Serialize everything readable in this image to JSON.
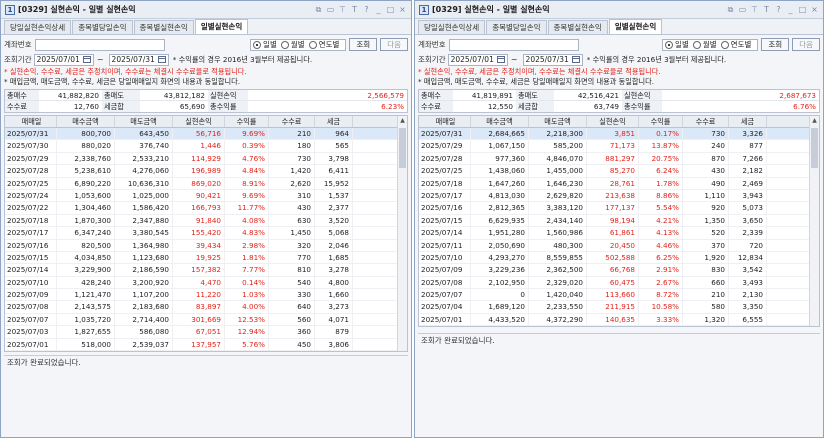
{
  "windows": [
    {
      "title": "[0329] 실현손익 - 일별 실현손익",
      "app_icon": "1",
      "tabs": [
        {
          "label": "당일실현손익상세"
        },
        {
          "label": "종목별당일손익"
        },
        {
          "label": "종목별실현손익"
        },
        {
          "label": "일별실현손익"
        }
      ],
      "account_label": "계좌번호",
      "radios": [
        {
          "label": "일별"
        },
        {
          "label": "월별"
        },
        {
          "label": "연도별"
        }
      ],
      "query_btn": "조회",
      "next_btn": "다음",
      "period_label": "조회기간",
      "date_from": "2025/07/01",
      "date_to": "2025/07/31",
      "date_tilde": "~",
      "note": "* 수익률의 경우 2016년 3월부터 제공됩니다.",
      "red_note": "* 실현손익, 수수료, 세금은 추정치이며, 수수료는 체결시 수수료율로 적용됩니다.",
      "black_note": "* 매입금액, 매도금액, 수수료, 세금은 당일매매일지 화면의 내용과 동일합니다.",
      "summary": {
        "l_buy": "총매수",
        "buy": "41,882,820",
        "l_sell": "총매도",
        "sell": "43,812,182",
        "l_pl": "실현손익",
        "pl": "2,566,579",
        "l_fee": "수수료",
        "fee": "12,760",
        "l_tax": "세금합",
        "tax": "65,690",
        "l_rate": "총수익률",
        "rate": "6.23%"
      },
      "headers": [
        "매매일",
        "매수금액",
        "매도금액",
        "실현손익",
        "수익률",
        "수수료",
        "세금"
      ],
      "rows": [
        {
          "d": "2025/07/31",
          "b": "800,700",
          "s": "643,450",
          "p": "56,716",
          "r": "9.69%",
          "f": "210",
          "t": "964",
          "c": "pos"
        },
        {
          "d": "2025/07/30",
          "b": "880,020",
          "s": "376,740",
          "p": "1,446",
          "r": "0.39%",
          "f": "180",
          "t": "565",
          "c": "pos"
        },
        {
          "d": "2025/07/29",
          "b": "2,338,760",
          "s": "2,533,210",
          "p": "114,929",
          "r": "4.76%",
          "f": "730",
          "t": "3,798",
          "c": "pos"
        },
        {
          "d": "2025/07/28",
          "b": "5,238,610",
          "s": "4,276,060",
          "p": "196,989",
          "r": "4.84%",
          "f": "1,420",
          "t": "6,411",
          "c": "pos"
        },
        {
          "d": "2025/07/25",
          "b": "6,890,220",
          "s": "10,636,310",
          "p": "869,020",
          "r": "8.91%",
          "f": "2,620",
          "t": "15,952",
          "c": "pos"
        },
        {
          "d": "2025/07/24",
          "b": "1,053,600",
          "s": "1,025,000",
          "p": "90,421",
          "r": "9.69%",
          "f": "310",
          "t": "1,537",
          "c": "pos"
        },
        {
          "d": "2025/07/22",
          "b": "1,304,460",
          "s": "1,586,420",
          "p": "166,793",
          "r": "11.77%",
          "f": "430",
          "t": "2,377",
          "c": "pos"
        },
        {
          "d": "2025/07/18",
          "b": "1,870,300",
          "s": "2,347,880",
          "p": "91,840",
          "r": "4.08%",
          "f": "630",
          "t": "3,520",
          "c": "pos"
        },
        {
          "d": "2025/07/17",
          "b": "6,347,240",
          "s": "3,380,545",
          "p": "155,420",
          "r": "4.83%",
          "f": "1,450",
          "t": "5,068",
          "c": "pos"
        },
        {
          "d": "2025/07/16",
          "b": "820,500",
          "s": "1,364,980",
          "p": "39,434",
          "r": "2.98%",
          "f": "320",
          "t": "2,046",
          "c": "pos"
        },
        {
          "d": "2025/07/15",
          "b": "4,034,850",
          "s": "1,123,680",
          "p": "19,925",
          "r": "1.81%",
          "f": "770",
          "t": "1,685",
          "c": "pos"
        },
        {
          "d": "2025/07/14",
          "b": "3,229,900",
          "s": "2,186,590",
          "p": "157,382",
          "r": "7.77%",
          "f": "810",
          "t": "3,278",
          "c": "pos"
        },
        {
          "d": "2025/07/10",
          "b": "428,240",
          "s": "3,200,920",
          "p": "4,470",
          "r": "0.14%",
          "f": "540",
          "t": "4,800",
          "c": "pos"
        },
        {
          "d": "2025/07/09",
          "b": "1,121,470",
          "s": "1,107,200",
          "p": "11,220",
          "r": "1.03%",
          "f": "330",
          "t": "1,660",
          "c": "pos"
        },
        {
          "d": "2025/07/08",
          "b": "2,143,575",
          "s": "2,183,680",
          "p": "83,897",
          "r": "4.00%",
          "f": "640",
          "t": "3,273",
          "c": "pos"
        },
        {
          "d": "2025/07/07",
          "b": "1,035,720",
          "s": "2,714,400",
          "p": "301,669",
          "r": "12.53%",
          "f": "560",
          "t": "4,071",
          "c": "pos"
        },
        {
          "d": "2025/07/03",
          "b": "1,827,655",
          "s": "586,080",
          "p": "67,051",
          "r": "12.94%",
          "f": "360",
          "t": "879",
          "c": "pos"
        },
        {
          "d": "2025/07/01",
          "b": "518,000",
          "s": "2,539,037",
          "p": "137,957",
          "r": "5.76%",
          "f": "450",
          "t": "3,806",
          "c": "pos"
        }
      ],
      "status": "조회가 완료되었습니다."
    },
    {
      "title": "[0329] 실현손익 - 일별 실현손익",
      "app_icon": "1",
      "tabs": [
        {
          "label": "당일실현손익상세"
        },
        {
          "label": "종목별당일손익"
        },
        {
          "label": "종목별실현손익"
        },
        {
          "label": "일별실현손익"
        }
      ],
      "account_label": "계좌번호",
      "radios": [
        {
          "label": "일별"
        },
        {
          "label": "월별"
        },
        {
          "label": "연도별"
        }
      ],
      "query_btn": "조회",
      "next_btn": "다음",
      "period_label": "조회기간",
      "date_from": "2025/07/01",
      "date_to": "2025/07/31",
      "date_tilde": "~",
      "note": "* 수익률의 경우 2016년 3월부터 제공됩니다.",
      "red_note": "* 실현손익, 수수료, 세금은 추정치이며, 수수료는 체결시 수수료율로 적용됩니다.",
      "black_note": "* 매입금액, 매도금액, 수수료, 세금은 당일매매일지 화면의 내용과 동일합니다.",
      "summary": {
        "l_buy": "총매수",
        "buy": "41,819,891",
        "l_sell": "총매도",
        "sell": "42,516,421",
        "l_pl": "실현손익",
        "pl": "2,687,673",
        "l_fee": "수수료",
        "fee": "12,550",
        "l_tax": "세금합",
        "tax": "63,749",
        "l_rate": "총수익률",
        "rate": "6.76%"
      },
      "headers": [
        "매매일",
        "매수금액",
        "매도금액",
        "실현손익",
        "수익률",
        "수수료",
        "세금"
      ],
      "rows": [
        {
          "d": "2025/07/31",
          "b": "2,684,665",
          "s": "2,218,300",
          "p": "3,851",
          "r": "0.17%",
          "f": "730",
          "t": "3,326",
          "c": "pos"
        },
        {
          "d": "2025/07/29",
          "b": "1,067,150",
          "s": "585,200",
          "p": "71,173",
          "r": "13.87%",
          "f": "240",
          "t": "877",
          "c": "pos"
        },
        {
          "d": "2025/07/28",
          "b": "977,360",
          "s": "4,846,070",
          "p": "881,297",
          "r": "20.75%",
          "f": "870",
          "t": "7,266",
          "c": "pos"
        },
        {
          "d": "2025/07/25",
          "b": "1,438,060",
          "s": "1,455,000",
          "p": "85,270",
          "r": "6.24%",
          "f": "430",
          "t": "2,182",
          "c": "pos"
        },
        {
          "d": "2025/07/18",
          "b": "1,647,260",
          "s": "1,646,230",
          "p": "28,761",
          "r": "1.78%",
          "f": "490",
          "t": "2,469",
          "c": "pos"
        },
        {
          "d": "2025/07/17",
          "b": "4,813,030",
          "s": "2,629,820",
          "p": "213,638",
          "r": "8.86%",
          "f": "1,110",
          "t": "3,943",
          "c": "pos"
        },
        {
          "d": "2025/07/16",
          "b": "2,812,365",
          "s": "3,383,120",
          "p": "177,137",
          "r": "5.54%",
          "f": "920",
          "t": "5,073",
          "c": "pos"
        },
        {
          "d": "2025/07/15",
          "b": "6,629,935",
          "s": "2,434,140",
          "p": "98,194",
          "r": "4.21%",
          "f": "1,350",
          "t": "3,650",
          "c": "pos"
        },
        {
          "d": "2025/07/14",
          "b": "1,951,280",
          "s": "1,560,986",
          "p": "61,861",
          "r": "4.13%",
          "f": "520",
          "t": "2,339",
          "c": "pos"
        },
        {
          "d": "2025/07/11",
          "b": "2,050,690",
          "s": "480,300",
          "p": "20,450",
          "r": "4.46%",
          "f": "370",
          "t": "720",
          "c": "pos"
        },
        {
          "d": "2025/07/10",
          "b": "4,293,270",
          "s": "8,559,855",
          "p": "502,588",
          "r": "6.25%",
          "f": "1,920",
          "t": "12,834",
          "c": "pos"
        },
        {
          "d": "2025/07/09",
          "b": "3,229,236",
          "s": "2,362,500",
          "p": "66,768",
          "r": "2.91%",
          "f": "830",
          "t": "3,542",
          "c": "pos"
        },
        {
          "d": "2025/07/08",
          "b": "2,102,950",
          "s": "2,329,020",
          "p": "60,475",
          "r": "2.67%",
          "f": "660",
          "t": "3,493",
          "c": "pos"
        },
        {
          "d": "2025/07/07",
          "b": "0",
          "s": "1,420,040",
          "p": "113,660",
          "r": "8.72%",
          "f": "210",
          "t": "2,130",
          "c": "pos"
        },
        {
          "d": "2025/07/04",
          "b": "1,689,120",
          "s": "2,233,550",
          "p": "211,915",
          "r": "10.58%",
          "f": "580",
          "t": "3,350",
          "c": "pos"
        },
        {
          "d": "2025/07/01",
          "b": "4,433,520",
          "s": "4,372,290",
          "p": "140,635",
          "r": "3.33%",
          "f": "1,320",
          "t": "6,555",
          "c": "pos"
        }
      ],
      "status": "조회가 완료되었습니다."
    }
  ],
  "colors": {
    "positive": "#e2231a",
    "selected_row": "#dbe8f8",
    "accent": "#8fa3c4"
  }
}
